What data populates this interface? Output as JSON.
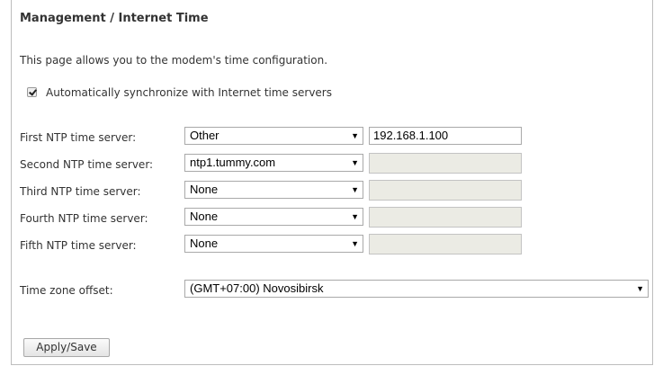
{
  "page": {
    "title": "Management / Internet Time",
    "description": "This page allows you to the modem's time configuration."
  },
  "auto_sync": {
    "checked": true,
    "label": "Automatically synchronize with Internet time servers"
  },
  "ntp_servers": [
    {
      "label": "First NTP time server:",
      "selected": "Other",
      "custom_value": "192.168.1.100",
      "custom_enabled": true
    },
    {
      "label": "Second NTP time server:",
      "selected": "ntp1.tummy.com",
      "custom_value": "",
      "custom_enabled": false
    },
    {
      "label": "Third NTP time server:",
      "selected": "None",
      "custom_value": "",
      "custom_enabled": false
    },
    {
      "label": "Fourth NTP time server:",
      "selected": "None",
      "custom_value": "",
      "custom_enabled": false
    },
    {
      "label": "Fifth NTP time server:",
      "selected": "None",
      "custom_value": "",
      "custom_enabled": false
    }
  ],
  "timezone": {
    "label": "Time zone offset:",
    "selected": "(GMT+07:00) Novosibirsk"
  },
  "apply_button": {
    "label": "Apply/Save"
  },
  "icons": {
    "select_arrow": "triangle-down-icon",
    "checkbox": "checkmark-icon"
  }
}
